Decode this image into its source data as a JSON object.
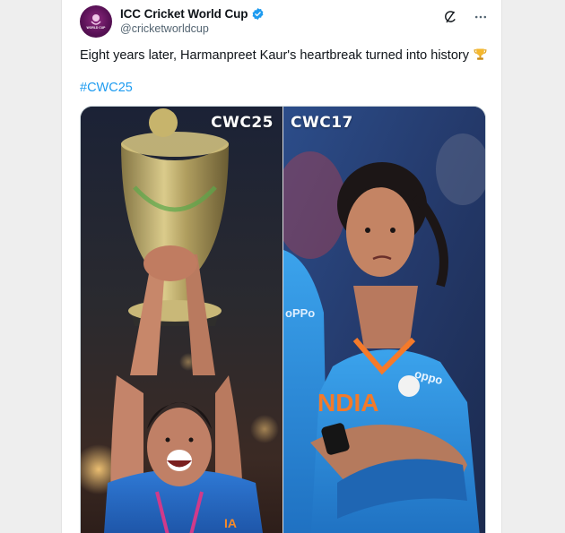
{
  "tweet": {
    "author": {
      "display_name": "ICC Cricket World Cup",
      "handle": "@cricketworldcup",
      "verified": true,
      "avatar_icon": "icc-logo-icon",
      "avatar_text": "WORLD CUP"
    },
    "text": "Eight years later, Harmanpreet Kaur's heartbreak turned into history",
    "emoji": "trophy-icon",
    "hashtag": "#CWC25",
    "media": {
      "left_label": "CWC25",
      "right_label": "CWC17"
    },
    "actions": {
      "grok_icon": "grok-icon",
      "more_icon": "more-icon"
    }
  },
  "colors": {
    "link": "#1d9bf0",
    "verified": "#1d9bf0",
    "text": "#0f1419",
    "secondary": "#536471"
  }
}
